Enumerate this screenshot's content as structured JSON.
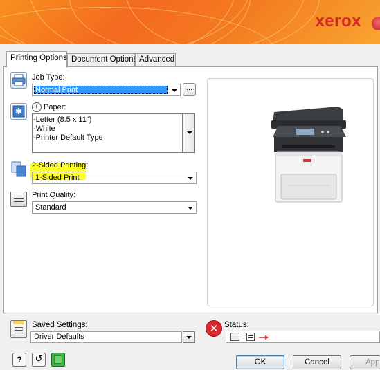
{
  "header": {
    "brand": "xerox"
  },
  "tabs": [
    {
      "label": "Printing Options",
      "active": true
    },
    {
      "label": "Document Options",
      "active": false
    },
    {
      "label": "Advanced",
      "active": false
    }
  ],
  "job_type": {
    "label": "Job Type:",
    "value": "Normal Print",
    "more_label": "..."
  },
  "paper": {
    "label": "Paper:",
    "lines": [
      "-Letter (8.5 x 11\")",
      "-White",
      "-Printer Default Type"
    ]
  },
  "two_sided": {
    "label": "2-Sided Printing:",
    "value": "1-Sided Print",
    "highlight_color": "#ffff00"
  },
  "print_quality": {
    "label": "Print Quality:",
    "value": "Standard"
  },
  "saved_settings": {
    "label": "Saved Settings:",
    "value": "Driver Defaults"
  },
  "status": {
    "label": "Status:",
    "status_icon": "error-x-icon",
    "status_color": "#d9272e"
  },
  "buttons": {
    "ok": "OK",
    "cancel": "Cancel",
    "apply": "Apply",
    "help": "?"
  },
  "colors": {
    "brand_red": "#d8262e",
    "banner_orange": "#f47a20",
    "selection_blue": "#3399ff"
  }
}
